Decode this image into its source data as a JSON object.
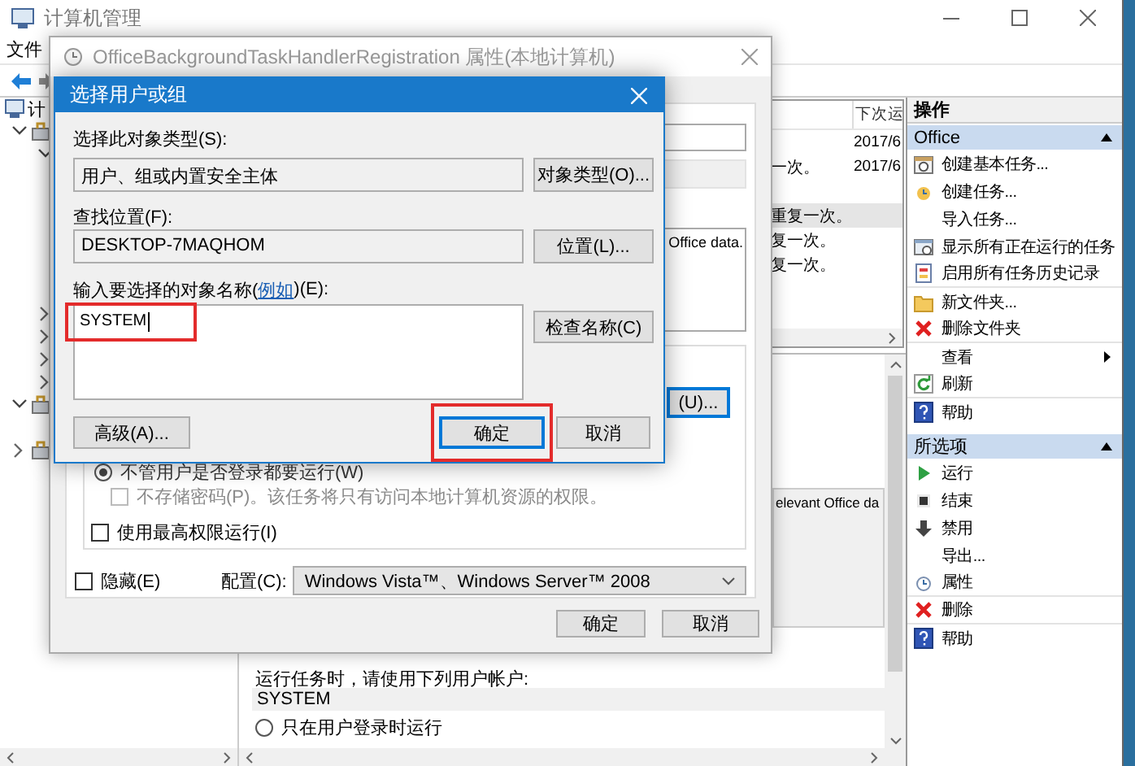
{
  "main_window": {
    "title": "计算机管理",
    "menu": [
      "文件"
    ],
    "tree": {
      "label": "计",
      "children": [
        {
          "expanded": true,
          "children": [
            {
              "expanded": true
            },
            {
              "expanded": false
            },
            {
              "expanded": false
            },
            {
              "expanded": false
            },
            {
              "expanded": false
            }
          ]
        },
        {
          "expanded": true
        },
        {
          "expanded": false
        }
      ]
    },
    "task_table": {
      "headers": {
        "column_2": "下次运"
      },
      "rows": [
        {
          "selected": false,
          "column_2": "2017/6"
        },
        {
          "selected": false,
          "column_1": "一次。",
          "column_2": "2017/6"
        },
        {
          "selected": false
        },
        {
          "selected": true,
          "column_1": "重复一次。"
        },
        {
          "selected": false,
          "column_1": "复一次。"
        },
        {
          "selected": false,
          "column_1": "复一次。"
        }
      ]
    },
    "details": {
      "description": "elevant Office da",
      "security_label": "运行任务时，请使用下列用户帐户:",
      "account": "SYSTEM",
      "run_options": [
        {
          "label": "只在用户登录时运行",
          "selected": false
        }
      ]
    },
    "actions": {
      "title": "操作",
      "sections": [
        {
          "title": "Office",
          "expanded": true,
          "items": [
            {
              "label": "创建基本任务...",
              "kind": "schedule",
              "separator": false
            },
            {
              "label": "创建任务...",
              "kind": "create",
              "separator": false
            },
            {
              "label": "导入任务...",
              "kind": "import",
              "separator": false
            },
            {
              "label": "显示所有正在运行的任务",
              "kind": "running",
              "separator": false
            },
            {
              "label": "启用所有任务历史记录",
              "kind": "history",
              "separator": true
            },
            {
              "label": "新文件夹...",
              "kind": "folder",
              "separator": false
            },
            {
              "label": "删除文件夹",
              "kind": "remove",
              "separator": true
            },
            {
              "label": "查看",
              "kind": "view",
              "separator": false
            },
            {
              "label": "刷新",
              "kind": "refresh",
              "separator": true
            },
            {
              "label": "帮助",
              "kind": "help",
              "separator": false
            }
          ]
        },
        {
          "title": "所选项",
          "expanded": true,
          "items": [
            {
              "label": "运行",
              "kind": "run",
              "separator": false
            },
            {
              "label": "结束",
              "kind": "end",
              "separator": false
            },
            {
              "label": "禁用",
              "kind": "disable",
              "separator": false
            },
            {
              "label": "导出...",
              "kind": "export",
              "separator": false
            },
            {
              "label": "属性",
              "kind": "properties",
              "separator": true
            },
            {
              "label": "删除",
              "kind": "remove",
              "separator": true
            },
            {
              "label": "帮助",
              "kind": "help",
              "separator": false
            }
          ]
        }
      ]
    }
  },
  "properties_dialog": {
    "title": "OfficeBackgroundTaskHandlerRegistration 属性(本地计算机)",
    "description": "Office data.",
    "change_button": "(U)...",
    "run_options": [
      {
        "label": "不管用户是否登录都要运行(W)",
        "selected": true
      }
    ],
    "no_password": {
      "label": "不存储密码(P)。该任务将只有访问本地计算机资源的权限。",
      "checked": false,
      "disabled": true
    },
    "highest_privileges": {
      "label": "使用最高权限运行(I)",
      "checked": false
    },
    "hidden": {
      "label": "隐藏(E)",
      "checked": false
    },
    "configure": {
      "label": "配置(C):",
      "value": "Windows Vista™、Windows Server™ 2008"
    },
    "buttons": [
      "确定",
      "取消"
    ]
  },
  "select_dialog": {
    "title": "选择用户或组",
    "object_type": {
      "label": "选择此对象类型(S):",
      "value": "用户、组或内置安全主体",
      "button": "对象类型(O)..."
    },
    "location": {
      "label": "查找位置(F):",
      "value": "DESKTOP-7MAQHOM",
      "button": "位置(L)..."
    },
    "names": {
      "label_before": "输入要选择的对象名称(",
      "link": "例如",
      "label_after": ")(E):",
      "value": "SYSTEM",
      "highlighted": true,
      "button": "检查名称(C)"
    },
    "advanced_button": "高级(A)...",
    "ok": {
      "label": "确定",
      "highlighted": true
    },
    "cancel": "取消"
  }
}
